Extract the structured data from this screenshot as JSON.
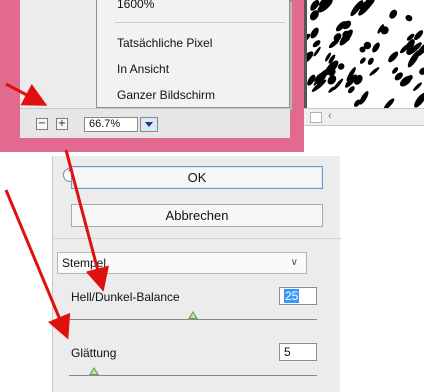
{
  "zoom_menu": {
    "items": [
      {
        "label": "1600%"
      },
      {
        "label": "Tatsächliche Pixel"
      },
      {
        "label": "In Ansicht"
      },
      {
        "label": "Ganzer Bildschirm"
      }
    ]
  },
  "statusbar": {
    "zoom_out_symbol": "−",
    "zoom_in_symbol": "+",
    "zoom_value": "66.7%"
  },
  "right_scroll": {
    "arrow_symbol": "‹"
  },
  "dialog": {
    "collapse_symbol": "⌃",
    "ok_label": "OK",
    "cancel_label": "Abbrechen",
    "mode_select": {
      "value": "Stempel",
      "chevron": "∨"
    },
    "params": [
      {
        "label": "Hell/Dunkel-Balance",
        "value": "25",
        "slider": 0.5
      },
      {
        "label": "Glättung",
        "value": "5",
        "slider": 0.1
      }
    ]
  },
  "annotation": {
    "arrow_color": "#e0100e"
  },
  "colors": {
    "pink_frame": "#e26a8e",
    "ok_focus_border": "#6a9ad4",
    "selection_highlight": "#3399ff"
  }
}
